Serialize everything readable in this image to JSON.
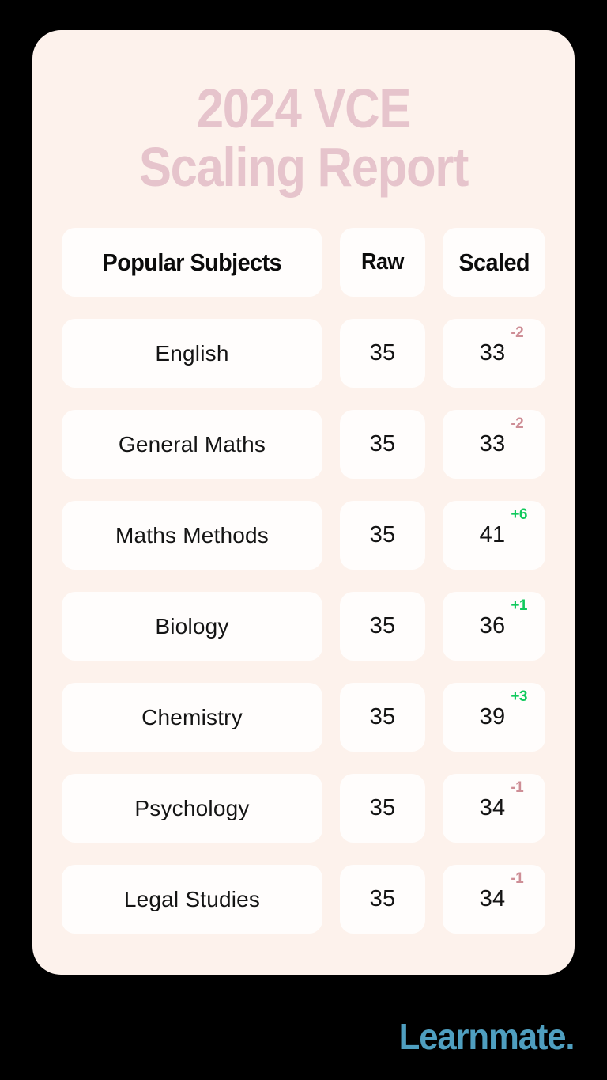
{
  "background_color": "#000000",
  "card": {
    "background_color": "#FDF2EC"
  },
  "header": {
    "title_line1": "2024 VCE",
    "title_line2": "Scaling Report",
    "title_color": "#E6C4CC"
  },
  "table": {
    "columns": [
      {
        "key": "subject",
        "label": "Popular Subjects"
      },
      {
        "key": "raw",
        "label": "Raw"
      },
      {
        "key": "scaled",
        "label": "Scaled"
      }
    ],
    "rows": [
      {
        "subject": "English",
        "raw": "35",
        "scaled": "33",
        "delta": "-2",
        "delta_direction": "down"
      },
      {
        "subject": "General Maths",
        "raw": "35",
        "scaled": "33",
        "delta": "-2",
        "delta_direction": "down"
      },
      {
        "subject": "Maths Methods",
        "raw": "35",
        "scaled": "41",
        "delta": "+6",
        "delta_direction": "up"
      },
      {
        "subject": "Biology",
        "raw": "35",
        "scaled": "36",
        "delta": "+1",
        "delta_direction": "up"
      },
      {
        "subject": "Chemistry",
        "raw": "35",
        "scaled": "39",
        "delta": "+3",
        "delta_direction": "up"
      },
      {
        "subject": "Psychology",
        "raw": "35",
        "scaled": "34",
        "delta": "-1",
        "delta_direction": "down"
      },
      {
        "subject": "Legal Studies",
        "raw": "35",
        "scaled": "34",
        "delta": "-1",
        "delta_direction": "down"
      }
    ],
    "delta_up_color": "#10C95C",
    "delta_down_color": "#CE8E96"
  },
  "footer": {
    "logo_text": "Learnmate.",
    "logo_color": "#4F9FC0"
  }
}
